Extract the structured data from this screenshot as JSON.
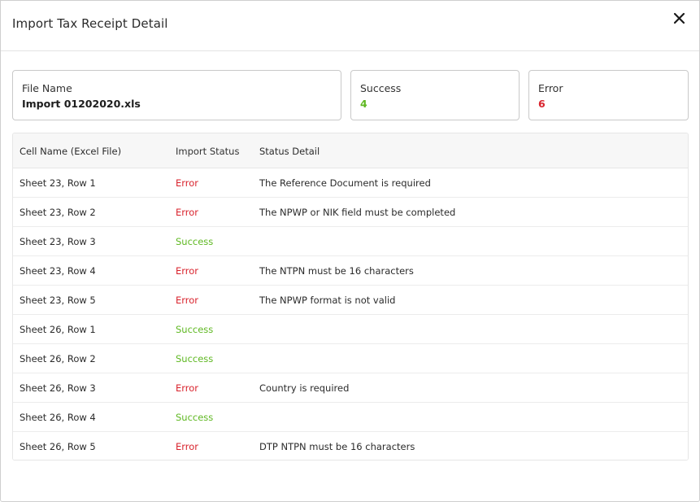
{
  "modal": {
    "title": "Import Tax Receipt Detail",
    "close_icon": "close-icon"
  },
  "summary": {
    "file_name_label": "File Name",
    "file_name_value": "Import 01202020.xls",
    "success_label": "Success",
    "success_value": "4",
    "error_label": "Error",
    "error_value": "6"
  },
  "colors": {
    "success": "#5fb822",
    "error": "#d9232d"
  },
  "table": {
    "columns": [
      "Cell Name (Excel File)",
      "Import Status",
      "Status Detail"
    ],
    "rows": [
      {
        "cell": "Sheet 23, Row 1",
        "status": "Error",
        "detail": "The Reference Document is required"
      },
      {
        "cell": "Sheet 23, Row 2",
        "status": "Error",
        "detail": "The NPWP or NIK field must be completed"
      },
      {
        "cell": "Sheet 23, Row 3",
        "status": "Success",
        "detail": ""
      },
      {
        "cell": "Sheet 23, Row 4",
        "status": "Error",
        "detail": "The NTPN must be 16 characters"
      },
      {
        "cell": "Sheet 23, Row 5",
        "status": "Error",
        "detail": "The NPWP format is not valid"
      },
      {
        "cell": "Sheet 26, Row 1",
        "status": "Success",
        "detail": ""
      },
      {
        "cell": "Sheet 26, Row 2",
        "status": "Success",
        "detail": ""
      },
      {
        "cell": "Sheet 26, Row 3",
        "status": "Error",
        "detail": "Country is required"
      },
      {
        "cell": "Sheet 26, Row 4",
        "status": "Success",
        "detail": ""
      },
      {
        "cell": "Sheet 26, Row 5",
        "status": "Error",
        "detail": "DTP NTPN must be 16 characters"
      }
    ]
  }
}
